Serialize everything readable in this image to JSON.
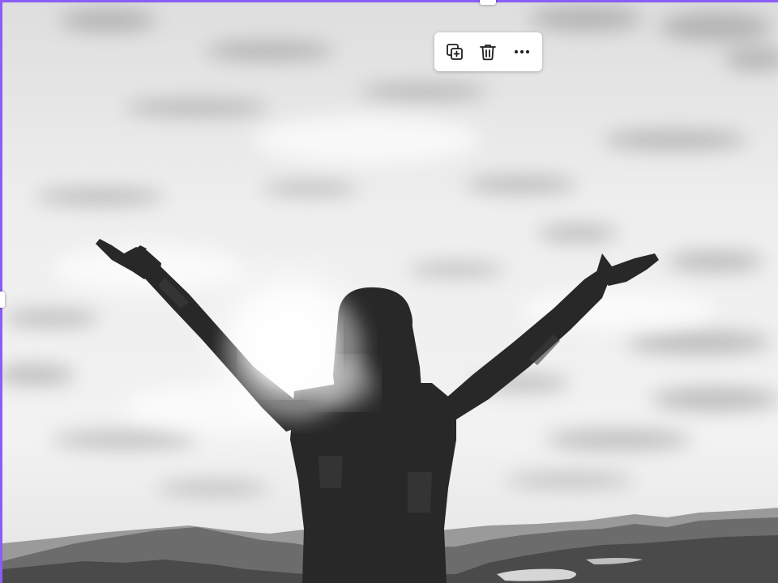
{
  "editor": {
    "selection_color": "#8b5cf6"
  },
  "photo": {
    "subject": "woman-raising-arms",
    "colors": {
      "sky_light": "#f4f4f4",
      "sky_mid": "#e2e2e2",
      "cloud_shadow": "#9a9a9a",
      "mountain_far": "#8d8d8d",
      "mountain_near": "#4a4a4a",
      "silhouette": "#262626"
    }
  },
  "toolbar": {
    "items": [
      {
        "name": "duplicate-button",
        "icon": "duplicate-icon"
      },
      {
        "name": "delete-button",
        "icon": "trash-icon"
      },
      {
        "name": "more-options-button",
        "icon": "more-dots-icon"
      }
    ],
    "icon_color": "#1f1f1f"
  }
}
